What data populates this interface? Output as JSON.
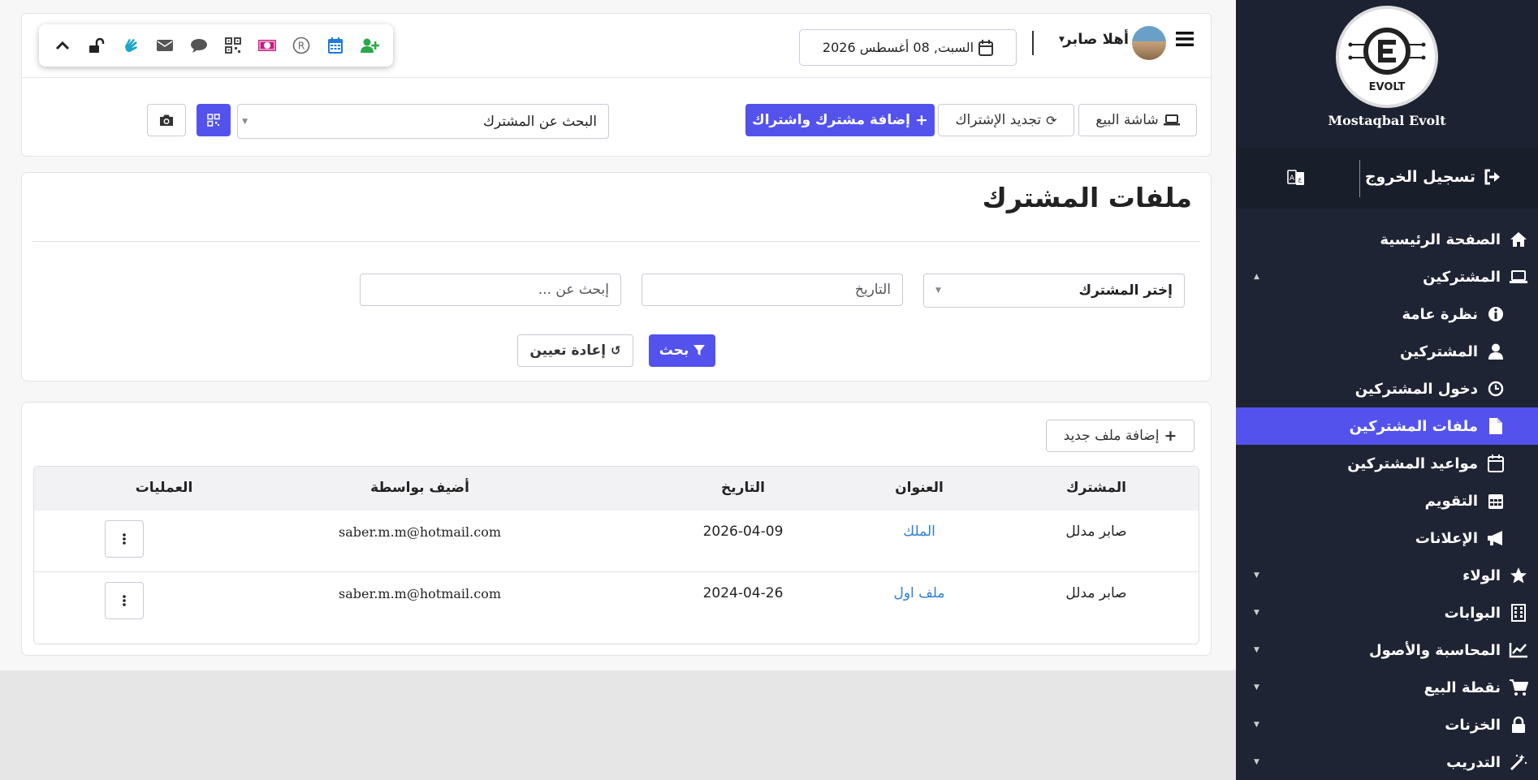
{
  "brand": {
    "name": "Mostaqbal Evolt",
    "logo_text": "EVOLT"
  },
  "sidebar": {
    "logout_label": "تسجيل الخروج",
    "items": [
      {
        "label": "الصفحة الرئيسية",
        "icon": "home-icon"
      },
      {
        "label": "المشتركين",
        "icon": "laptop-icon",
        "expanded": true
      },
      {
        "label": "نظرة عامة",
        "icon": "info-icon",
        "sub": true
      },
      {
        "label": "المشتركين",
        "icon": "user-icon",
        "sub": true
      },
      {
        "label": "دخول المشتركين",
        "icon": "clock-icon",
        "sub": true
      },
      {
        "label": "ملفات المشتركين",
        "icon": "file-icon",
        "sub": true,
        "active": true
      },
      {
        "label": "مواعيد المشتركين",
        "icon": "calendar-icon",
        "sub": true
      },
      {
        "label": "التقويم",
        "icon": "calendar-grid-icon",
        "sub": true
      },
      {
        "label": "الإعلانات",
        "icon": "megaphone-icon",
        "sub": true
      },
      {
        "label": "الولاء",
        "icon": "star-icon"
      },
      {
        "label": "البوابات",
        "icon": "building-icon"
      },
      {
        "label": "المحاسبة والأصول",
        "icon": "chart-line-icon"
      },
      {
        "label": "نقطة البيع",
        "icon": "cart-icon"
      },
      {
        "label": "الخزنات",
        "icon": "lock-icon"
      },
      {
        "label": "التدريب",
        "icon": "magic-wand-icon"
      }
    ]
  },
  "header": {
    "user_greeting": "أهلا صابر",
    "date": "السبت, 08 أغسطس 2026",
    "buttons": {
      "pos": "شاشة البيع",
      "renew": "تجديد الإشتراك",
      "add_member": "إضافة مشترك واشتراك"
    },
    "member_search_placeholder": "البحث عن المشترك"
  },
  "toolbar_icons": [
    "chevron-up-icon",
    "unlock-icon",
    "hand-icon",
    "envelope-icon",
    "comment-icon",
    "qrcode-icon",
    "money-icon",
    "registered-icon",
    "calendar-icon",
    "user-plus-icon"
  ],
  "page": {
    "title": "ملفات المشترك",
    "filters": {
      "member_select": "إختر المشترك",
      "date_placeholder": "التاريخ",
      "search_placeholder": "إبحث عن ...",
      "search_button": "بحث",
      "reset_button": "إعادة تعيين"
    },
    "add_file_button": "إضافة ملف جديد"
  },
  "table": {
    "columns": [
      "المشترك",
      "العنوان",
      "التاريخ",
      "أضيف بواسطة",
      "العمليات"
    ],
    "rows": [
      {
        "member": "صابر مدلل",
        "title": "الملك",
        "date": "2026-04-09",
        "added_by": "saber.m.m@hotmail.com"
      },
      {
        "member": "صابر مدلل",
        "title": "ملف اول",
        "date": "2024-04-26",
        "added_by": "saber.m.m@hotmail.com"
      }
    ]
  },
  "colors": {
    "primary": "#5352ed",
    "sidebar": "#1e2433",
    "link": "#2f7fd8"
  }
}
